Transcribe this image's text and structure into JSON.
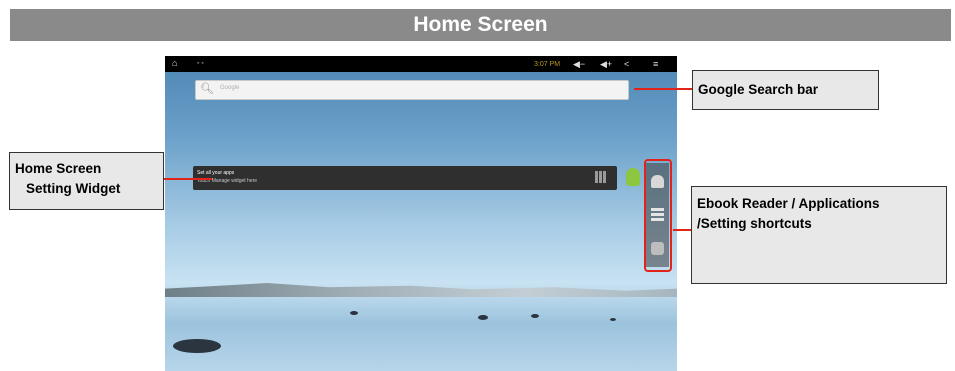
{
  "title": "Home Screen",
  "tablet": {
    "status_time": "3:07 PM",
    "search_placeholder": "Google",
    "widget_line1": "Set all your apps",
    "widget_line2": "Touch Manage widget here"
  },
  "callouts": {
    "google": "Google Search bar",
    "home_line1": "Home Screen",
    "home_line2": "Setting Widget",
    "ebook_line1": "Ebook Reader / Applications",
    "ebook_line2": "/Setting shortcuts"
  },
  "colors": {
    "title_bar": "#8a8a8a",
    "leader_lines": "#e2231a",
    "callout_bg": "#e8e8e8"
  }
}
